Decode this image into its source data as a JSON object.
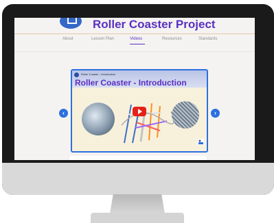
{
  "header": {
    "title": "Roller Coaster Project"
  },
  "nav": {
    "items": [
      {
        "label": "About",
        "active": false
      },
      {
        "label": "Lesson Plan",
        "active": false
      },
      {
        "label": "Videos",
        "active": true
      },
      {
        "label": "Resources",
        "active": false
      },
      {
        "label": "Standards",
        "active": false
      }
    ]
  },
  "video": {
    "channel_text": "Roller Coaster - Introduction",
    "title": "Roller Coaster - Introduction"
  },
  "icons": {
    "left_arrow": "chevron-left-icon",
    "right_arrow": "chevron-right-icon",
    "play": "play-icon"
  },
  "colors": {
    "brand_purple": "#5a2fc2",
    "accent_blue": "#2c6fe0",
    "youtube_red": "#e62117"
  }
}
